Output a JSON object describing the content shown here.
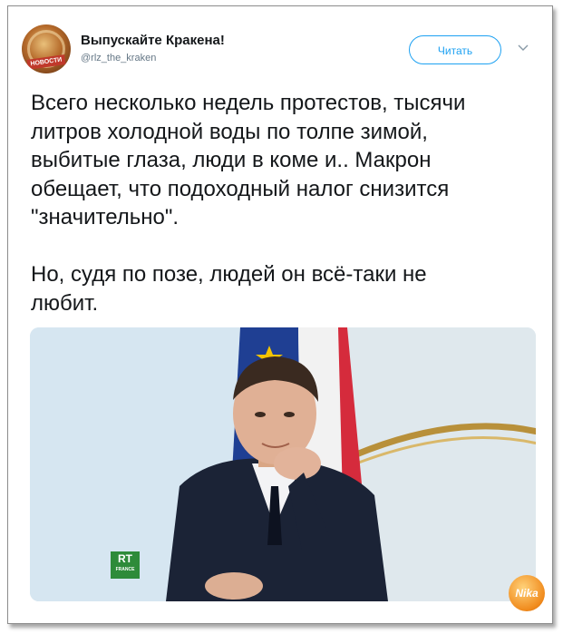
{
  "tweet": {
    "display_name": "Выпускайте Кракена!",
    "handle": "@rlz_the_kraken",
    "follow_label": "Читать",
    "paragraphs": [
      [
        "Всего несколько недель протестов, тысячи",
        "литров холодной воды по толпе зимой,",
        "выбитые глаза, люди в коме и.. Макрон",
        "обещает, что подоходный налог снизится",
        "\"значительно\"."
      ],
      [
        "Но, судя по позе, людей он всё-таки не",
        "любит."
      ]
    ],
    "avatar": {
      "badge_text": "НОВОСТИ"
    },
    "photo": {
      "channel_logo_line1": "RT",
      "channel_logo_line2": "FRANCE",
      "watermark": "Nika"
    }
  },
  "colors": {
    "accent": "#1da1f2",
    "text": "#14171a",
    "muted": "#657786",
    "rt_green": "#2e8b3a"
  },
  "icons": {
    "menu": "chevron-down-icon"
  }
}
